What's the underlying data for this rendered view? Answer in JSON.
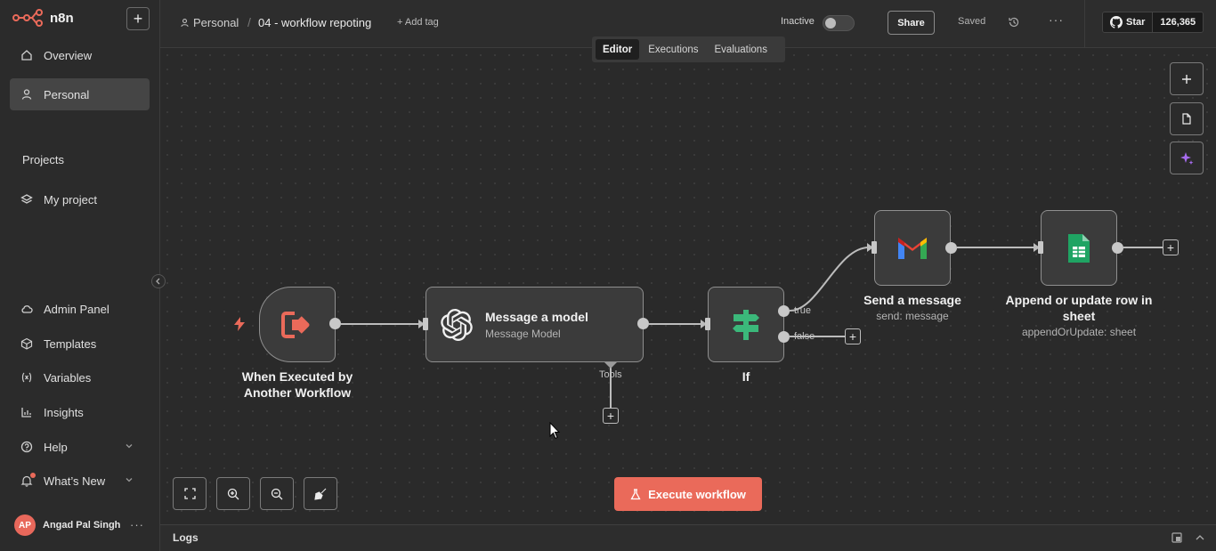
{
  "brand": {
    "name": "n8n"
  },
  "sidebar": {
    "items": [
      {
        "label": "Overview",
        "icon": "home-icon"
      },
      {
        "label": "Personal",
        "icon": "user-icon",
        "active": true
      }
    ],
    "section_title": "Projects",
    "projects": [
      {
        "label": "My project",
        "icon": "layers-icon"
      }
    ],
    "bottom_items": [
      {
        "label": "Admin Panel",
        "icon": "cloud-icon"
      },
      {
        "label": "Templates",
        "icon": "box-icon"
      },
      {
        "label": "Variables",
        "icon": "variable-icon"
      },
      {
        "label": "Insights",
        "icon": "chart-icon"
      },
      {
        "label": "Help",
        "icon": "help-icon"
      },
      {
        "label": "What’s New",
        "icon": "bell-icon"
      }
    ],
    "user": {
      "initials": "AP",
      "name": "Angad Pal Singh"
    }
  },
  "header": {
    "breadcrumb_project": "Personal",
    "workflow_name": "04 - workflow repoting",
    "add_tag": "+ Add tag",
    "status_label": "Inactive",
    "share_label": "Share",
    "saved_label": "Saved",
    "github": {
      "star_label": "Star",
      "count": "126,365"
    }
  },
  "tabs": [
    "Editor",
    "Executions",
    "Evaluations"
  ],
  "active_tab": "Editor",
  "nodes": {
    "trigger": {
      "title_line1": "When Executed by",
      "title_line2": "Another Workflow"
    },
    "openai": {
      "title": "Message a model",
      "subtitle": "Message Model",
      "tools_label": "Tools"
    },
    "if": {
      "title": "If",
      "true_label": "true",
      "false_label": "false"
    },
    "gmail": {
      "title": "Send a message",
      "subtitle": "send: message"
    },
    "sheets": {
      "title_line1": "Append or update row in",
      "title_line2": "sheet",
      "subtitle": "appendOrUpdate: sheet"
    }
  },
  "execute_label": "Execute workflow",
  "logs_label": "Logs",
  "colors": {
    "accent": "#ea6a5a",
    "if_green": "#3bb87a",
    "sheets_green": "#1fa463",
    "ai_purple": "#a76cf0"
  }
}
